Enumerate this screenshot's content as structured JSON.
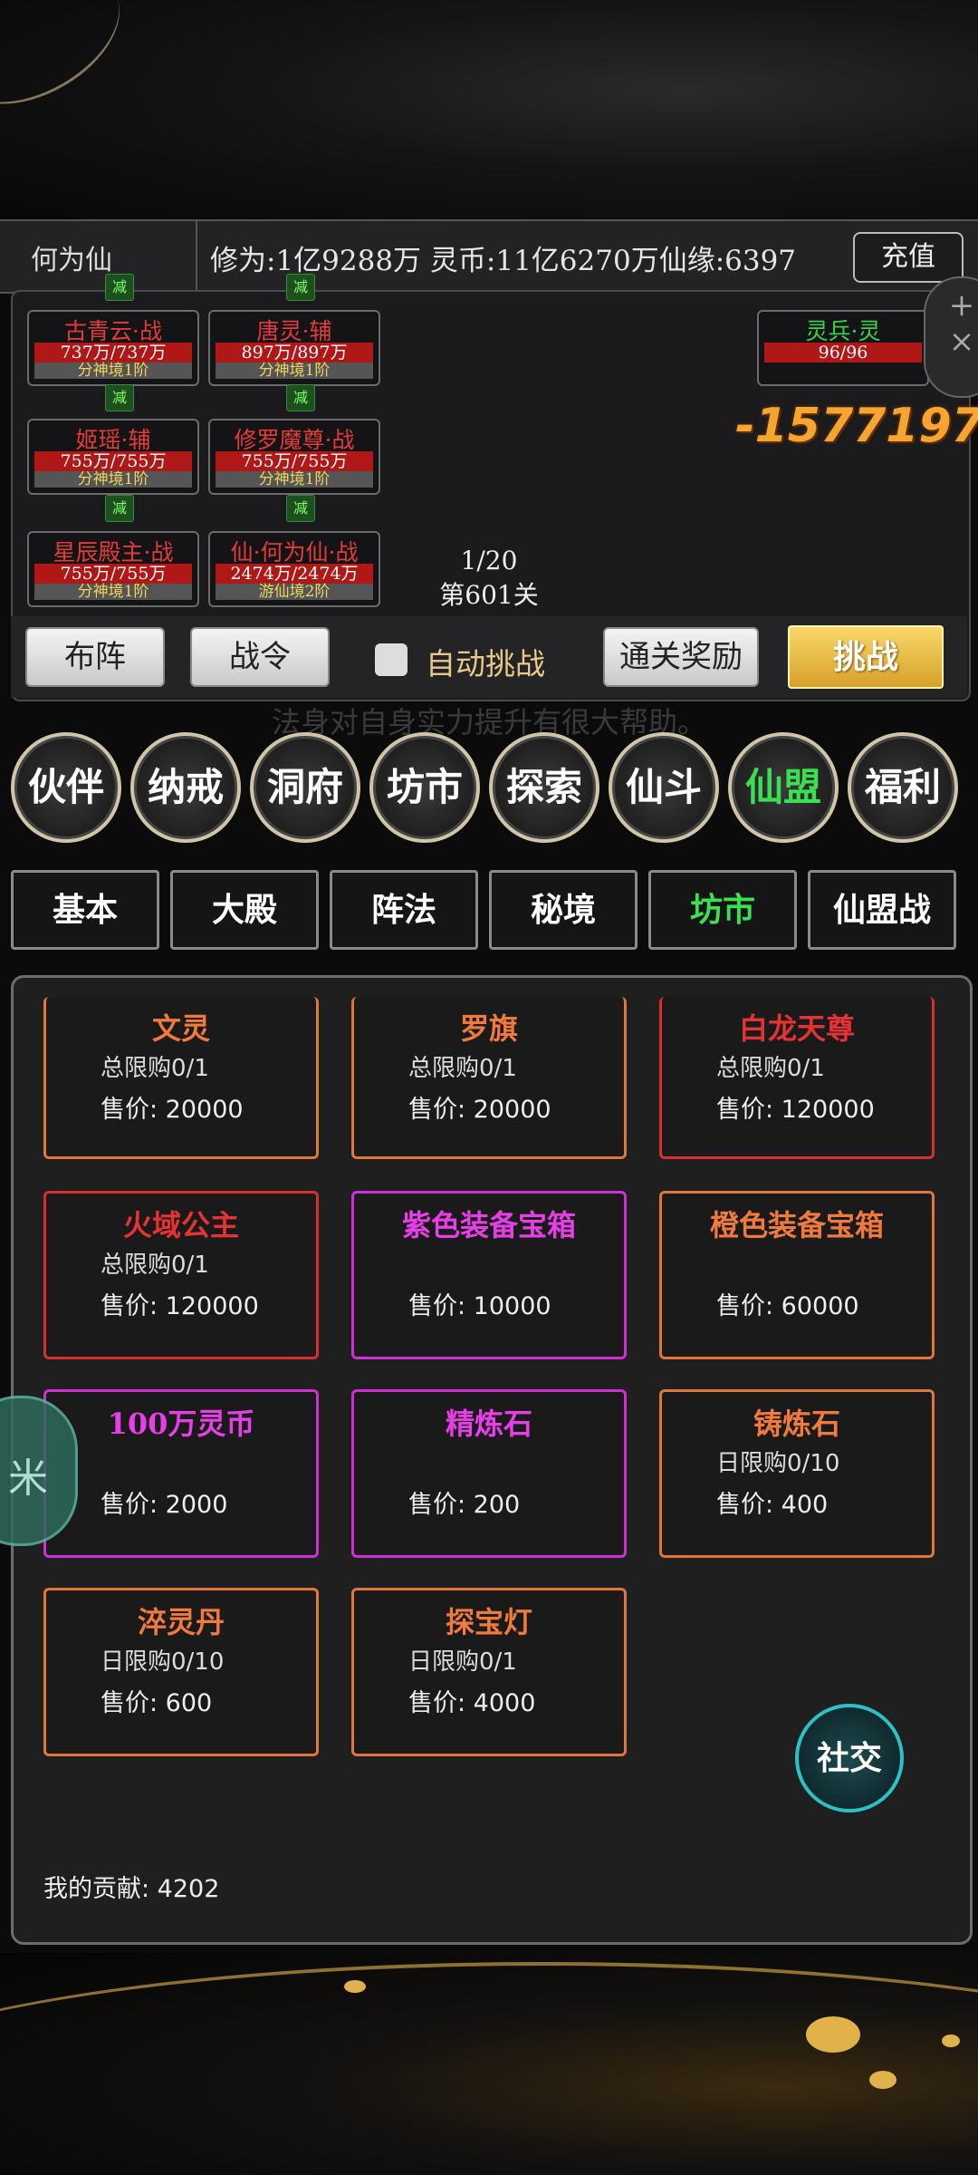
{
  "header": {
    "player_name": "何为仙",
    "stats_line": "修为:1亿9288万 灵币:11亿6270万仙缘:6397",
    "recharge_label": "充值"
  },
  "battle": {
    "left_units": [
      {
        "name": "古青云·战",
        "hp": "737万/737万",
        "realm": "分神境1阶"
      },
      {
        "name": "唐灵·辅",
        "hp": "897万/897万",
        "realm": "分神境1阶"
      },
      {
        "name": "姬瑶·辅",
        "hp": "755万/755万",
        "realm": "分神境1阶"
      },
      {
        "name": "修罗魔尊·战",
        "hp": "755万/755万",
        "realm": "分神境1阶"
      },
      {
        "name": "星辰殿主·战",
        "hp": "755万/755万",
        "realm": "分神境1阶"
      },
      {
        "name": "仙·何为仙·战",
        "hp": "2474万/2474万",
        "realm": "游仙境2阶"
      }
    ],
    "minus_tag": "减",
    "enemy": {
      "name": "灵兵·灵",
      "hp": "96/96"
    },
    "damage": "-1577197",
    "wave": "1/20",
    "stage": "第601关",
    "side_tool_plus": "+",
    "side_tool_close": "×"
  },
  "controls": {
    "formation": "布阵",
    "battle_order": "战令",
    "auto_challenge": "自动挑战",
    "clear_reward": "通关奖励",
    "challenge": "挑战",
    "hint": "法身对自身实力提升有很大帮助。"
  },
  "nav": [
    "伙伴",
    "纳戒",
    "洞府",
    "坊市",
    "探索",
    "仙斗",
    "仙盟",
    "福利"
  ],
  "nav_active": "仙盟",
  "tabs": [
    "基本",
    "大殿",
    "阵法",
    "秘境",
    "坊市",
    "仙盟战"
  ],
  "tab_active": "坊市",
  "shop": {
    "items": [
      {
        "name": "文灵",
        "limit": "总限购0/1",
        "price": "售价: 20000",
        "rarity": "orange"
      },
      {
        "name": "罗旗",
        "limit": "总限购0/1",
        "price": "售价: 20000",
        "rarity": "orange"
      },
      {
        "name": "白龙天尊",
        "limit": "总限购0/1",
        "price": "售价: 120000",
        "rarity": "red"
      },
      {
        "name": "火域公主",
        "limit": "总限购0/1",
        "price": "售价: 120000",
        "rarity": "red"
      },
      {
        "name": "紫色装备宝箱",
        "limit": "",
        "price": "售价: 10000",
        "rarity": "purple"
      },
      {
        "name": "橙色装备宝箱",
        "limit": "",
        "price": "售价: 60000",
        "rarity": "orange"
      },
      {
        "name": "100万灵币",
        "limit": "",
        "price": "售价: 2000",
        "rarity": "purple"
      },
      {
        "name": "精炼石",
        "limit": "",
        "price": "售价: 200",
        "rarity": "purple"
      },
      {
        "name": "铸炼石",
        "limit": "日限购0/10",
        "price": "售价: 400",
        "rarity": "orange"
      },
      {
        "name": "淬灵丹",
        "limit": "日限购0/10",
        "price": "售价: 600",
        "rarity": "orange"
      },
      {
        "name": "探宝灯",
        "limit": "日限购0/1",
        "price": "售价: 4000",
        "rarity": "orange"
      }
    ],
    "contribution": "我的贡献: 4202",
    "social": "社交",
    "left_float": "米"
  },
  "colors": {
    "orange": "#e0763a",
    "red": "#d6302c",
    "purple": "#d12fd6",
    "active_green": "#3be052",
    "gold": "#f7a531"
  }
}
